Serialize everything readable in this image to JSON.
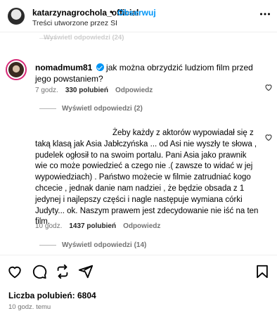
{
  "post_header": {
    "username": "katarzynagrochola_official",
    "separator": "•",
    "follow_label": "Obserwuj",
    "subtitle": "Treści utworzone przez SI"
  },
  "faded_thread": {
    "label": "Wyświetl odpowiedzi (24)"
  },
  "comment": {
    "username": "nomadmum81",
    "text": "jak można obrzydzić ludziom film przed jego powstaniem?",
    "age": "7 godz.",
    "likes": "330 polubień",
    "reply_label": "Odpowiedz",
    "view_replies": "Wyświetl odpowiedzi (2)"
  },
  "reply": {
    "text": "Żeby każdy z aktorów wypowiadał się z taką klasą jak Asia Jabłczyńska ... od Asi nie wyszły te słowa , pudelek ogłosił to na swoim portalu. Pani Asia jako prawnik wie co może powiedzieć a czego nie .( zawsze to widać w jej wypowiedziach) . Państwo możecie w filmie zatrudniać kogo chcecie , jednak danie nam nadziei , że będzie obsada z 1 jedynej i najlepszy części i nagle następuje wymiana córki Judyty... ok. Naszym prawem jest zdecydowanie nie iść na ten film.",
    "age": "10 godz.",
    "likes": "1437 polubień",
    "reply_label": "Odpowiedz",
    "view_replies": "Wyświetl odpowiedzi (14)"
  },
  "actions": {
    "likes_total": "Liczba polubień: 6804",
    "time_ago": "10 godz. temu"
  },
  "icons": {
    "more": "more-icon",
    "verified": "verified-badge-icon",
    "comment_like": "heart-icon",
    "like": "heart-icon",
    "comment": "comment-icon",
    "repost": "repost-icon",
    "share": "share-icon",
    "save": "bookmark-icon"
  },
  "colors": {
    "link_blue": "#0095f6",
    "muted_text": "#737373",
    "story_ring": "#d62976"
  }
}
